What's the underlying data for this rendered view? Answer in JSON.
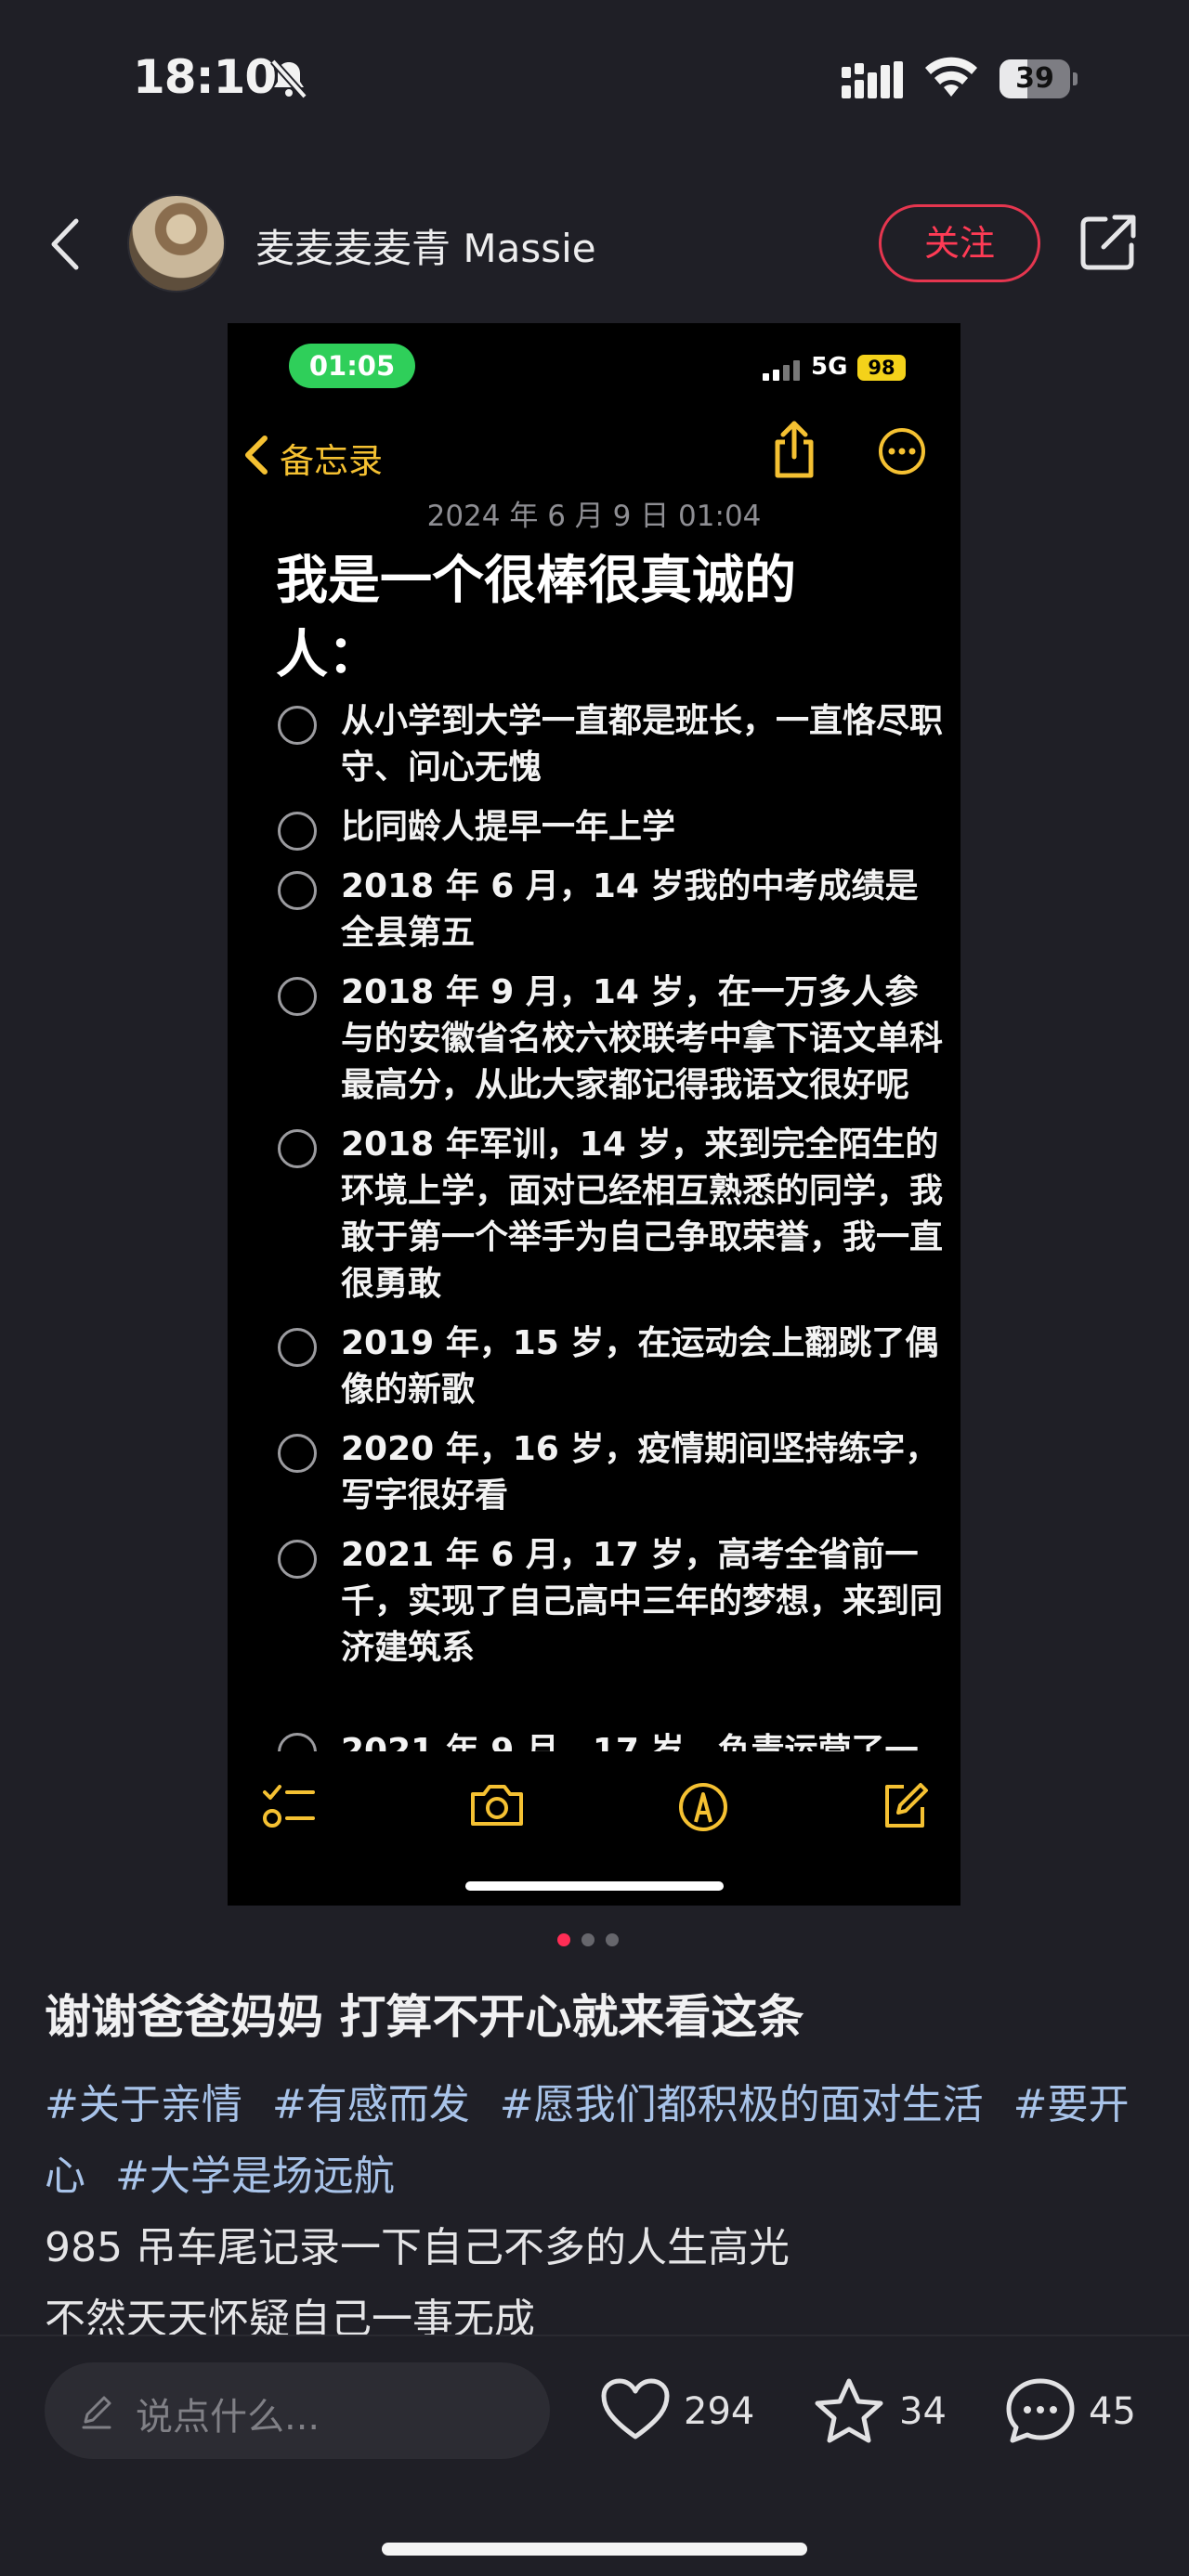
{
  "status_bar": {
    "time": "18:10",
    "battery": "39",
    "battery_level_percent": 39,
    "icons": [
      "bell-slash-icon",
      "cellular-signal-icon",
      "wifi-icon",
      "battery-icon"
    ]
  },
  "header": {
    "author_name": "麦麦麦麦青 Massie",
    "follow_label": "关注",
    "icons": [
      "back-icon",
      "avatar",
      "share-icon"
    ]
  },
  "screenshot": {
    "status_time": "01:05",
    "network": "5G",
    "battery": "98",
    "nav_back_label": "备忘录",
    "date": "2024 年 6 月 9 日 01:04",
    "title": "我是一个很棒很真诚的人：",
    "items": [
      {
        "text": "从小学到大学一直都是班长，一直恪尽职守、问心无愧"
      },
      {
        "text": "比同龄人提早一年上学"
      },
      {
        "text": "2018 年 6 月，14 岁我的中考成绩是全县第五"
      },
      {
        "text": "2018 年 9 月，14 岁，在一万多人参与的安徽省名校六校联考中拿下语文单科最高分，从此大家都记得我语文很好呢"
      },
      {
        "text": "2018 年军训，14 岁，来到完全陌生的环境上学，面对已经相互熟悉的同学，我敢于第一个举手为自己争取荣誉，我一直很勇敢"
      },
      {
        "text": "2019 年，15 岁，在运动会上翻跳了偶像的新歌"
      },
      {
        "text": "2020 年，16 岁，疫情期间坚持练字，写字很好看"
      },
      {
        "text": "2021 年 6 月，17 岁，高考全省前一千，实现了自己高中三年的梦想，来到同济建筑系"
      }
    ],
    "partial_item": "2021 年 9 月，17 岁，负责运营了一",
    "toolbar_icons": [
      "checklist-icon",
      "camera-icon",
      "markup-icon",
      "compose-icon"
    ]
  },
  "pagination": {
    "total": 3,
    "active": 1,
    "active_color": "#ff2d55"
  },
  "post": {
    "title": "谢谢爸爸妈妈 打算不开心就来看这条",
    "tags": [
      "#关于亲情",
      "#有感而发",
      "#愿我们都积极的面对生活",
      "#要开心",
      "#大学是场远航"
    ],
    "line1": "985 吊车尾记录一下自己不多的人生高光",
    "line2": "不然天天怀疑自己一事无成"
  },
  "bottom_bar": {
    "comment_placeholder": "说点什么...",
    "likes": "294",
    "favorites": "34",
    "comments": "45"
  }
}
